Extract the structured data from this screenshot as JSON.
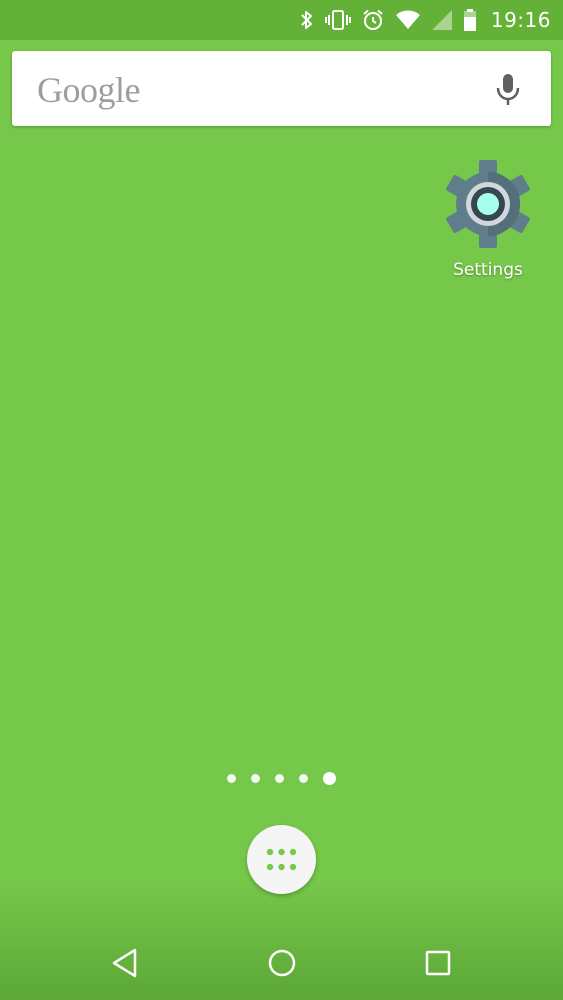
{
  "status_bar": {
    "time": "19:16",
    "icons": [
      "bluetooth-icon",
      "vibrate-icon",
      "alarm-icon",
      "wifi-icon",
      "cellular-signal-icon",
      "battery-icon"
    ]
  },
  "search_bar": {
    "logo_text": "Google",
    "icon": "microphone-icon"
  },
  "apps": [
    {
      "label": "Settings",
      "icon": "settings-gear-icon"
    }
  ],
  "page_indicator": {
    "pages": 5,
    "current_page": 5
  },
  "dock": {
    "all_apps_icon": "app-drawer-icon"
  },
  "nav_bar": {
    "buttons": [
      "back-icon",
      "home-icon",
      "recents-icon"
    ]
  },
  "colors": {
    "wallpaper": "#76c84a",
    "status_bar": "#64b138",
    "icon_white": "#ffffff",
    "gear": "#607d8b",
    "gear_center": "#a7ffeb"
  }
}
